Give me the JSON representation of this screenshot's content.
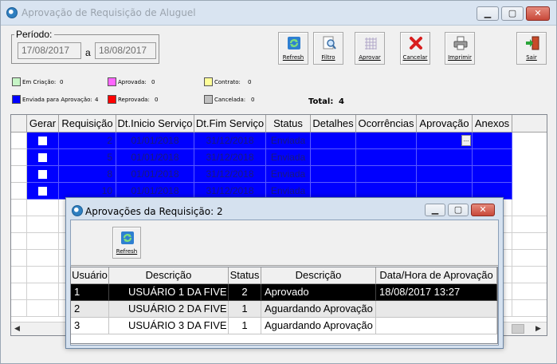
{
  "window": {
    "title": "Aprovação de Requisição de Aluguel"
  },
  "periodo": {
    "label": "Período:",
    "start": "17/08/2017",
    "separator": "a",
    "end": "18/08/2017"
  },
  "toolbar": {
    "refresh": "Refresh",
    "filtro": "Filtro",
    "aprovar": "Aprovar",
    "cancelar": "Cancelar",
    "imprimir": "Imprimir",
    "sair": "Sair"
  },
  "legend": {
    "em_criacao": "Em Criação:",
    "em_criacao_count": "0",
    "aprovada": "Aprovada:",
    "aprovada_count": "0",
    "contrato": "Contrato:",
    "contrato_count": "0",
    "enviada": "Enviada para Aprovação:",
    "enviada_count": "4",
    "reprovada": "Reprovada:",
    "reprovada_count": "0",
    "cancelada": "Cancelada:",
    "cancelada_count": "0",
    "total_label": "Total:",
    "total_value": "4",
    "colors": {
      "em_criacao": "#c6f5c6",
      "aprovada": "#ff66ff",
      "contrato": "#ffff99",
      "enviada": "#0000ff",
      "reprovada": "#ff0000",
      "cancelada": "#c0c0c0"
    }
  },
  "grid": {
    "headers": [
      "Gerar",
      "Requisição",
      "Dt.Inicio Serviço",
      "Dt.Fim Serviço",
      "Status",
      "Detalhes",
      "Ocorrências",
      "Aprovação",
      "Anexos"
    ],
    "rows": [
      {
        "requisicao": "2",
        "inicio": "01/01/2018",
        "fim": "31/12/2018",
        "status": "Enviada"
      },
      {
        "requisicao": "5",
        "inicio": "01/01/2018",
        "fim": "31/12/2018",
        "status": "Enviada"
      },
      {
        "requisicao": "8",
        "inicio": "01/01/2018",
        "fim": "31/12/2018",
        "status": "Enviada"
      },
      {
        "requisicao": "10",
        "inicio": "01/01/2018",
        "fim": "31/12/2018",
        "status": "Enviada"
      }
    ],
    "ellipsis": "..."
  },
  "dialog": {
    "title": "Aprovações da Requisição: 2",
    "refresh": "Refresh",
    "headers": [
      "Usuário",
      "Descrição",
      "Status",
      "Descrição",
      "Data/Hora de Aprovação"
    ],
    "rows": [
      {
        "usuario": "1",
        "descricao": "USUÁRIO 1 DA FIVE",
        "status": "2",
        "status_desc": "Aprovado",
        "data": "18/08/2017 13:27"
      },
      {
        "usuario": "2",
        "descricao": "USUÁRIO 2 DA FIVE",
        "status": "1",
        "status_desc": "Aguardando Aprovação",
        "data": ""
      },
      {
        "usuario": "3",
        "descricao": "USUÁRIO 3 DA FIVE",
        "status": "1",
        "status_desc": "Aguardando Aprovação",
        "data": ""
      }
    ]
  }
}
